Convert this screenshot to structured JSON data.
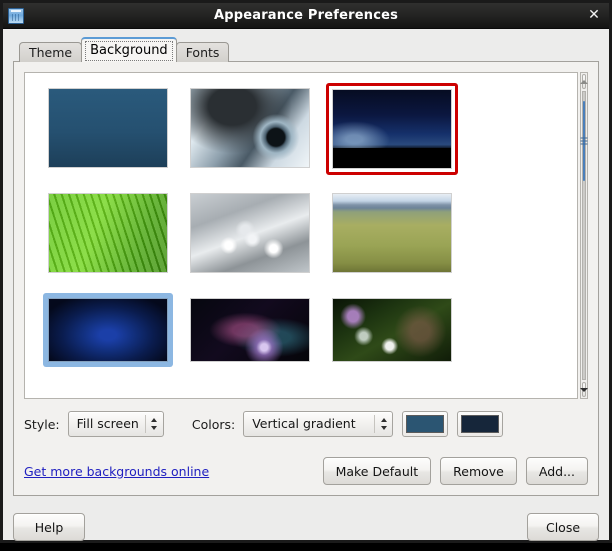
{
  "window": {
    "title": "Appearance Preferences",
    "icon": "preferences-icon",
    "close_label": "✕"
  },
  "tabs": [
    {
      "label": "Theme",
      "active": false
    },
    {
      "label": "Background",
      "active": true
    },
    {
      "label": "Fonts",
      "active": false
    }
  ],
  "wallpapers": [
    {
      "name": "solid-blue-gradient",
      "style": "wp-solidblue",
      "state": "normal"
    },
    {
      "name": "water-droplet",
      "style": "wp-droplet",
      "state": "normal"
    },
    {
      "name": "night-sky-horizon",
      "style": "wp-night",
      "state": "selected"
    },
    {
      "name": "green-leaf",
      "style": "wp-leaf",
      "state": "normal"
    },
    {
      "name": "grayscale-dew",
      "style": "wp-dew",
      "state": "normal"
    },
    {
      "name": "grass-field",
      "style": "wp-field",
      "state": "normal"
    },
    {
      "name": "dark-blue-desktop",
      "style": "wp-darkblue",
      "state": "highlighted"
    },
    {
      "name": "nebula-aurora",
      "style": "wp-nebula",
      "state": "stack"
    },
    {
      "name": "dew-drops-moss",
      "style": "wp-dewgreen",
      "state": "normal"
    }
  ],
  "scrollbar": {
    "up_arrow": "chevron-up-icon",
    "down_arrow": "chevron-down-icon",
    "thumb_position_percent": 3,
    "thumb_size_percent": 28
  },
  "controls": {
    "style_label": "Style:",
    "style_value": "Fill screen",
    "colors_label": "Colors:",
    "colors_value": "Vertical gradient",
    "primary_color": "#2b5572",
    "secondary_color": "#16263a"
  },
  "actions": {
    "link_label": "Get more backgrounds online",
    "make_default_label": "Make Default",
    "remove_label": "Remove",
    "add_label": "Add..."
  },
  "dialog": {
    "help_label": "Help",
    "close_label": "Close"
  }
}
